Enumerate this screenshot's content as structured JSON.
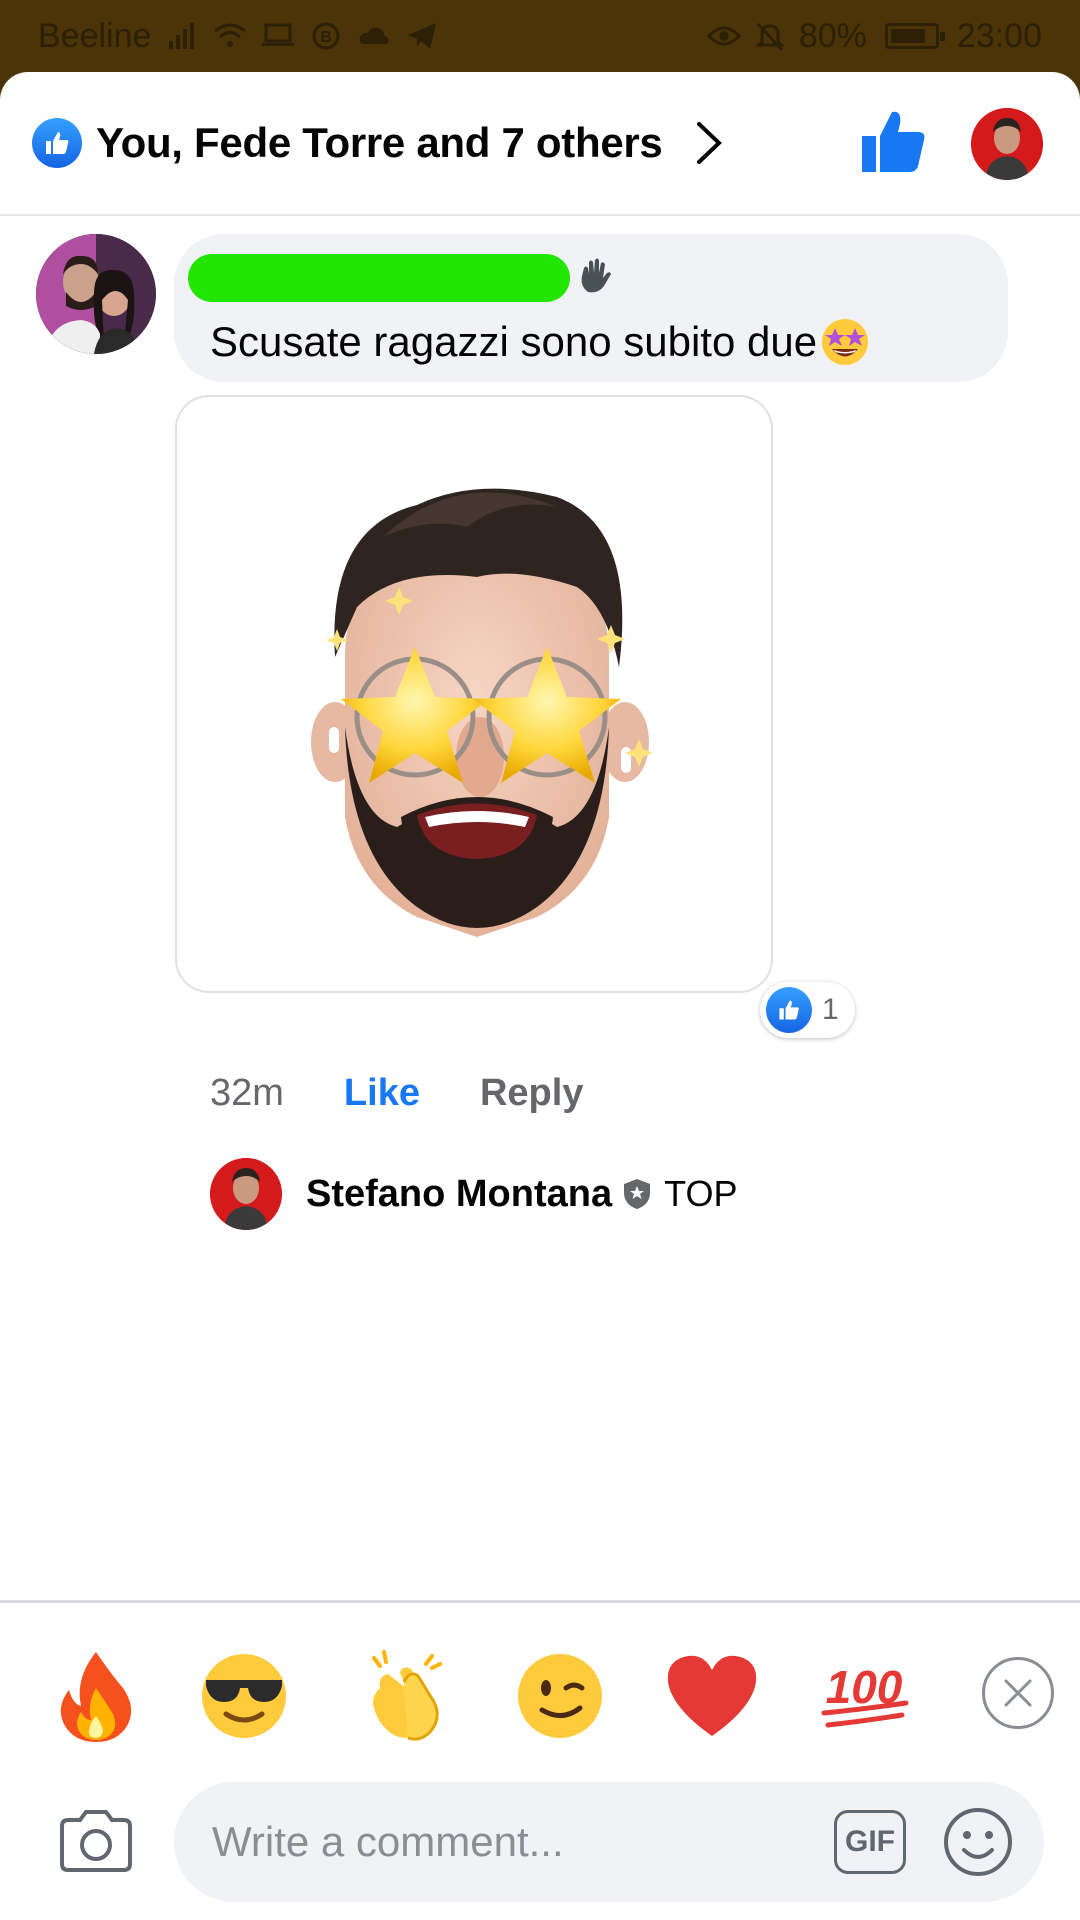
{
  "status_bar": {
    "carrier": "Beeline",
    "battery": "80%",
    "time": "23:00"
  },
  "header": {
    "reactors_text": "You, Fede Torre and 7 others"
  },
  "comment": {
    "text": "Scusate ragazzi sono subito due",
    "reaction_count": "1"
  },
  "actions": {
    "time": "32m",
    "like": "Like",
    "reply": "Reply"
  },
  "reply_preview": {
    "name": "Stefano Montana",
    "badge": "TOP"
  },
  "quick_emojis": [
    "fire",
    "sunglasses",
    "clapping",
    "wink",
    "heart",
    "hundred"
  ],
  "composer": {
    "placeholder": "Write a comment...",
    "gif_label": "GIF"
  },
  "colors": {
    "accent_blue": "#1877f2",
    "redaction_green": "#22e600",
    "status_bar": "#4a3408"
  }
}
